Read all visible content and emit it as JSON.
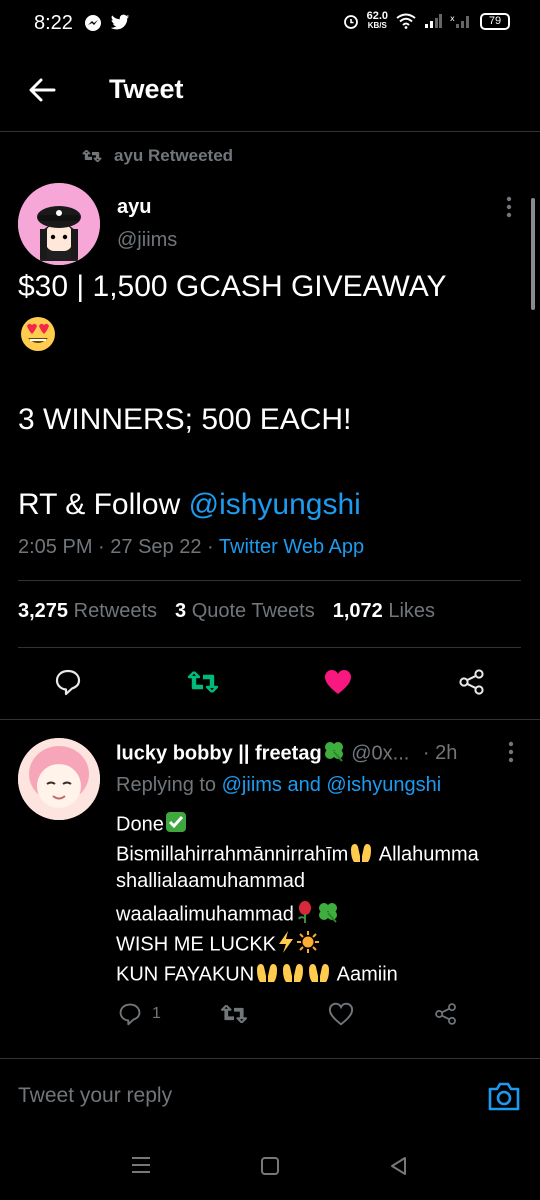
{
  "status_bar": {
    "time": "8:22",
    "net_speed": "62.0",
    "net_unit": "KB/S",
    "battery": "79"
  },
  "header": {
    "title": "Tweet"
  },
  "tweet": {
    "retweet_context": "ayu Retweeted",
    "author_name": "ayu",
    "author_handle": "@jiims",
    "line1": "$30 | 1,500 GCASH GIVEAWAY",
    "line2": "3 WINNERS; 500 EACH!",
    "line3_prefix": "RT & Follow ",
    "line3_mention": "@ishyungshi",
    "time": "2:05 PM",
    "date": "27 Sep 22",
    "source": "Twitter Web App",
    "stats": {
      "retweets_count": "3,275",
      "retweets_label": "Retweets",
      "quotes_count": "3",
      "quotes_label": "Quote Tweets",
      "likes_count": "1,072",
      "likes_label": "Likes"
    }
  },
  "reply": {
    "name": "lucky bobby || freetag",
    "handle": "@0x...",
    "time": "· 2h",
    "replying_prefix": "Replying to ",
    "replying_user1": "@jiims",
    "replying_and": " and ",
    "replying_user2": "@ishyungshi",
    "line1": "Done",
    "line2a": "Bismillahirrahmānnirrahīm",
    "line2b": " Allahumma",
    "line3": "shallialaamuhammad",
    "line4": "waalaalimuhammad",
    "line5": "WISH ME LUCKK",
    "line6a": "KUN FAYAKUN",
    "line6b": " Aamiin",
    "reply_count": "1"
  },
  "compose": {
    "placeholder": "Tweet your reply"
  },
  "colors": {
    "accent": "#1d9bf0",
    "retweet": "#00ba7c",
    "like": "#f91880",
    "background": "#000000"
  }
}
